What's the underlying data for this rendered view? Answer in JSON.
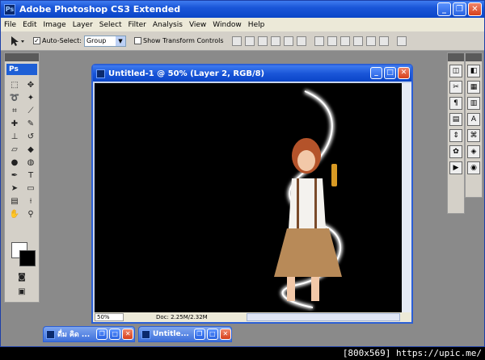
{
  "window": {
    "title": "Adobe Photoshop CS3 Extended",
    "app_icon": "Ps"
  },
  "menu": [
    "File",
    "Edit",
    "Image",
    "Layer",
    "Select",
    "Filter",
    "Analysis",
    "View",
    "Window",
    "Help"
  ],
  "options": {
    "auto_select_label": "Auto-Select:",
    "auto_select_checked": true,
    "auto_select_value": "Group",
    "transform_label": "Show Transform Controls",
    "transform_checked": false
  },
  "toolbox": {
    "label": "Ps"
  },
  "document": {
    "title": "Untitled-1 @ 50% (Layer 2, RGB/8)",
    "zoom": "50%",
    "doc_info": "Doc: 2.25M/2.32M"
  },
  "taskbar": [
    {
      "label": "ดื่ม คิด ..."
    },
    {
      "label": "Untitle..."
    }
  ],
  "watermark": "[800x569] https://upic.me/",
  "colors": {
    "accent": "#1a56d8",
    "chrome": "#d4d0c8",
    "workspace": "#8a8a8a"
  }
}
